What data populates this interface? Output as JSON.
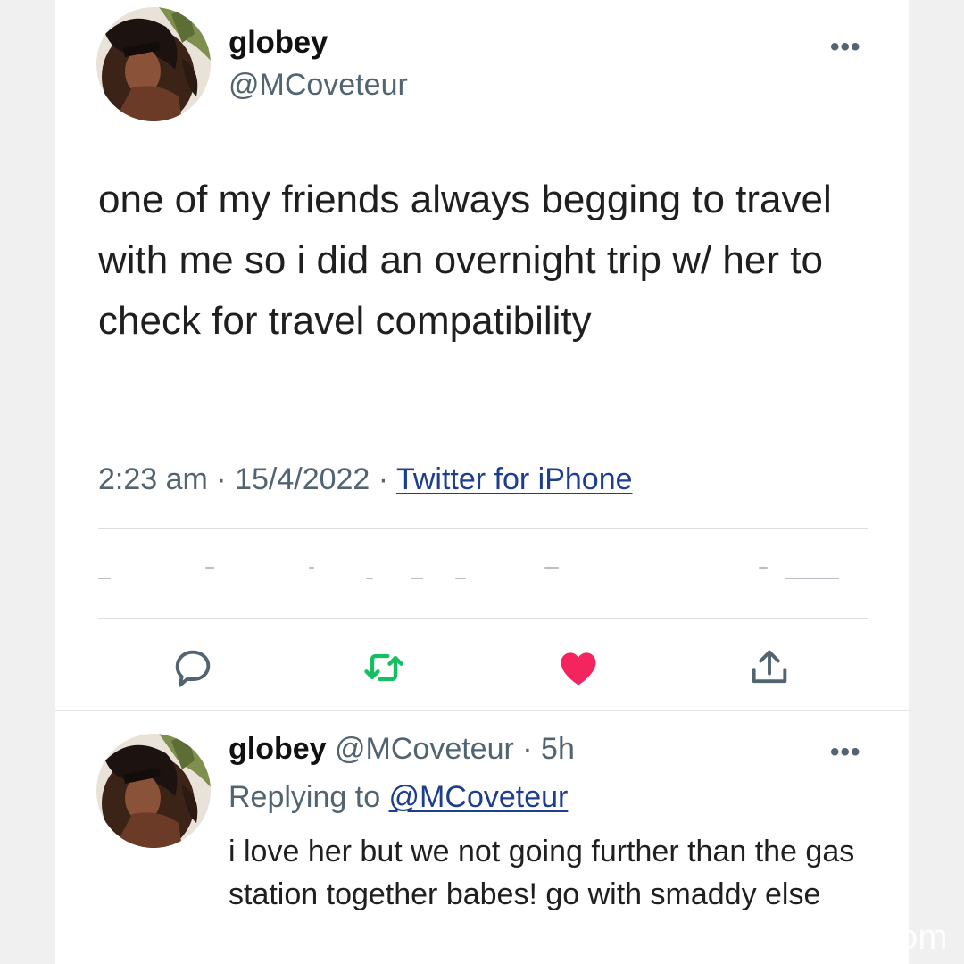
{
  "tweet": {
    "author_name": "globey",
    "author_handle": "@MCoveteur",
    "text": "one of my friends always begging to travel with me so i did an overnight trip w/ her to check for travel compatibility",
    "time": "2:23 am",
    "date": "15/4/2022",
    "sep1": " · ",
    "sep2": " · ",
    "source": "Twitter for iPhone",
    "more_icon": "•••",
    "actions": [
      {
        "name": "reply-icon",
        "color": "#536471"
      },
      {
        "name": "retweet-icon",
        "color": "#17bf63"
      },
      {
        "name": "like-icon",
        "color": "#f4245e"
      },
      {
        "name": "share-icon",
        "color": "#536471"
      }
    ]
  },
  "reply": {
    "author_name": "globey",
    "author_handle": "@MCoveteur",
    "age": "5h",
    "age_sep": " · ",
    "replying_prefix": "Replying to ",
    "replying_to": "@MCoveteur",
    "text": "i love her but we not going further than the gas station together babes! go with smaddy else",
    "more_icon": "•••"
  },
  "watermark": "om",
  "colors": {
    "link": "#1d3e8c",
    "secondary_text": "#536471",
    "like": "#f4245e",
    "retweet": "#17bf63"
  }
}
